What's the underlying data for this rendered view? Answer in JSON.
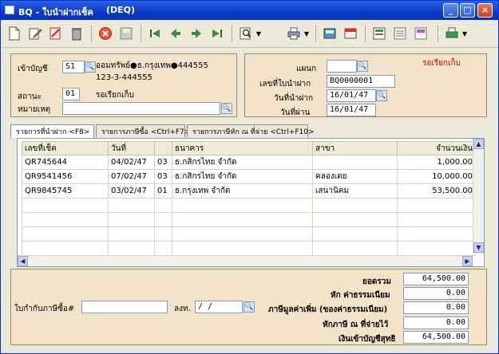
{
  "window": {
    "title": "BQ - ใบนำฝากเช็ค",
    "subtitle": "(DEQ)",
    "minimize": "_",
    "maximize": "□",
    "close": "×"
  },
  "toolbar": {
    "icons": [
      "new-icon",
      "edit-icon",
      "draw-icon",
      "delete-icon",
      "cancel-icon",
      "save-icon",
      "first-icon",
      "prev-icon",
      "next-icon",
      "last-icon",
      "search-icon",
      "print-icon",
      "calculator-icon",
      "report-icon",
      "doc-icon",
      "list-icon",
      "form-icon",
      "export-icon"
    ]
  },
  "header": {
    "account_label": "เข้าบัญชี",
    "account_code": "S1",
    "account_name": "ออมทรัพย์●ธ.กรุงเทพ●444555",
    "account_number": "123-3-444555",
    "status_label": "สถานะ",
    "status_code": "01",
    "status_text": "รอเรียกเก็บ",
    "note_label": "หมายเหตุ",
    "note_value": "",
    "dept_label": "แผนก",
    "dept_value": "",
    "deposit_no_label": "เลขที่ใบนำฝาก",
    "deposit_no": "BQ0000001",
    "deposit_date_label": "วันที่นำฝาก",
    "deposit_date": "16/01/47",
    "pass_date_label": "วันที่ผ่าน",
    "pass_date": "16/01/47",
    "status_badge": "รอเรียกเก็บ",
    "status_color": "#d40000"
  },
  "tabs": [
    {
      "label": "รายการที่นำฝาก <F8>"
    },
    {
      "label": "รายการภาษีซื้อ <Ctrl+F7>"
    },
    {
      "label": "รายการภาษีหัก ณ ที่จ่าย <Ctrl+F10>"
    }
  ],
  "grid": {
    "columns": [
      "เลขที่เช็ค",
      "วันที่",
      "ธนาคาร",
      "สาขา",
      "จำนวนเงิน"
    ],
    "rows": [
      {
        "cheque": "QR745644",
        "date": "04/02/47",
        "bank_code": "03",
        "bank": "ธ.กสิกรไทย จำกัด",
        "branch": "",
        "amount": "1,000.00"
      },
      {
        "cheque": "QR9541456",
        "date": "07/02/47",
        "bank_code": "03",
        "bank": "ธ.กสิกรไทย จำกัด",
        "branch": "คลองเตย",
        "amount": "10,000.00"
      },
      {
        "cheque": "QR9845745",
        "date": "03/02/47",
        "bank_code": "01",
        "bank": "ธ.กรุงเทพ จำกัด",
        "branch": "เสนานิคม",
        "amount": "53,500.00"
      }
    ]
  },
  "footer": {
    "tax_invoice_label": "ใบกำกับภาษีซื้อ#",
    "tax_invoice_value": "",
    "tax_date_label": "ลงท.",
    "tax_date_value": " /  / ",
    "total_label": "ยอดรวม",
    "total_value": "64,500.00",
    "fee_label": "หัก ค่าธรรมเนียม",
    "fee_value": "0.00",
    "vat_label": "ภาษีมูลค่าเพิ่ม (ของค่าธรรมเนียม)",
    "vat_value": "0.00",
    "wht_label": "หักภาษี ณ ที่จ่ายไว้",
    "wht_value": "0.00",
    "net_label": "เงินเข้าบัญชีสุทธิ",
    "net_value": "64,500.00"
  }
}
